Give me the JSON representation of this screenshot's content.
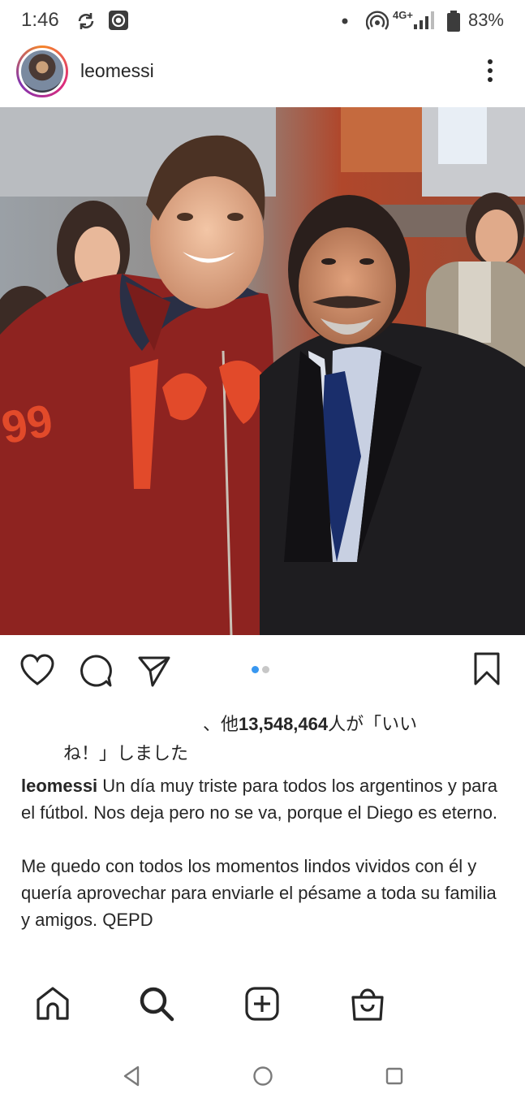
{
  "status_bar": {
    "time": "1:46",
    "network": "4G+",
    "battery": "83%"
  },
  "post": {
    "username": "leomessi",
    "likes_suffix": "、他",
    "likes_count": "13,548,464",
    "likes_text_1": "人が「いい",
    "likes_text_2": "ね！」しました",
    "caption_username": "leomessi",
    "caption_part1": " Un día muy triste para todos los argentinos y para el fútbol. Nos deja pero no se va, porque el Diego es eterno.",
    "caption_part2": "Me quedo con todos los momentos lindos vividos con él y quería aprovechar para enviarle el pésame a toda su familia y amigos. QEPD",
    "carousel": {
      "count": 2,
      "active": 1
    }
  },
  "colors": {
    "text": "#262626",
    "carousel_active": "#3897f0",
    "carousel_inactive": "#c7c7c7",
    "status_text": "#3c3c3c",
    "story_ring": [
      "#f58529",
      "#dd2a7b",
      "#8134af"
    ]
  },
  "icons": {
    "header": [
      "more-vertical-icon"
    ],
    "actions": [
      "heart-icon",
      "comment-icon",
      "share-icon",
      "bookmark-icon"
    ],
    "nav": [
      "home-icon",
      "search-icon",
      "add-post-icon",
      "shop-icon"
    ],
    "system": [
      "back-icon",
      "home-circle-icon",
      "recents-icon"
    ]
  }
}
